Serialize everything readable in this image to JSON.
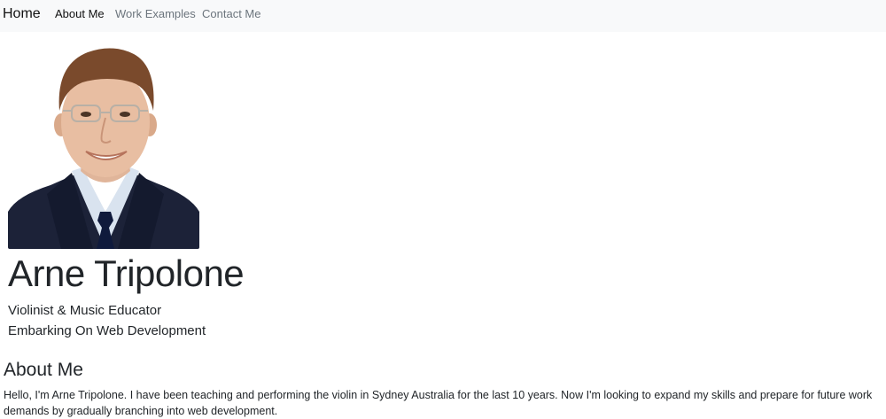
{
  "nav": {
    "brand": "Home",
    "links": [
      {
        "label": "About Me",
        "active": true
      },
      {
        "label": "Work Examples",
        "active": false
      },
      {
        "label": "Contact Me",
        "active": false
      }
    ]
  },
  "hero": {
    "photo_icon": "person-portrait",
    "name": "Arne Tripolone",
    "taglines": [
      "Violinist & Music Educator",
      "Embarking On Web Development"
    ]
  },
  "about": {
    "heading": "About Me",
    "body": "Hello, I'm Arne Tripolone. I have been teaching and performing the violin in Sydney Australia for the last 10 years. Now I'm looking to expand my skills and prepare for future work demands by gradually branching into web development."
  },
  "colors": {
    "navbar_bg": "#f8f9fa",
    "nav_inactive": "#6c757d",
    "text": "#212529",
    "suit": "#1c2238",
    "shirt": "#d9e3ef",
    "tie": "#0f1a3c"
  }
}
